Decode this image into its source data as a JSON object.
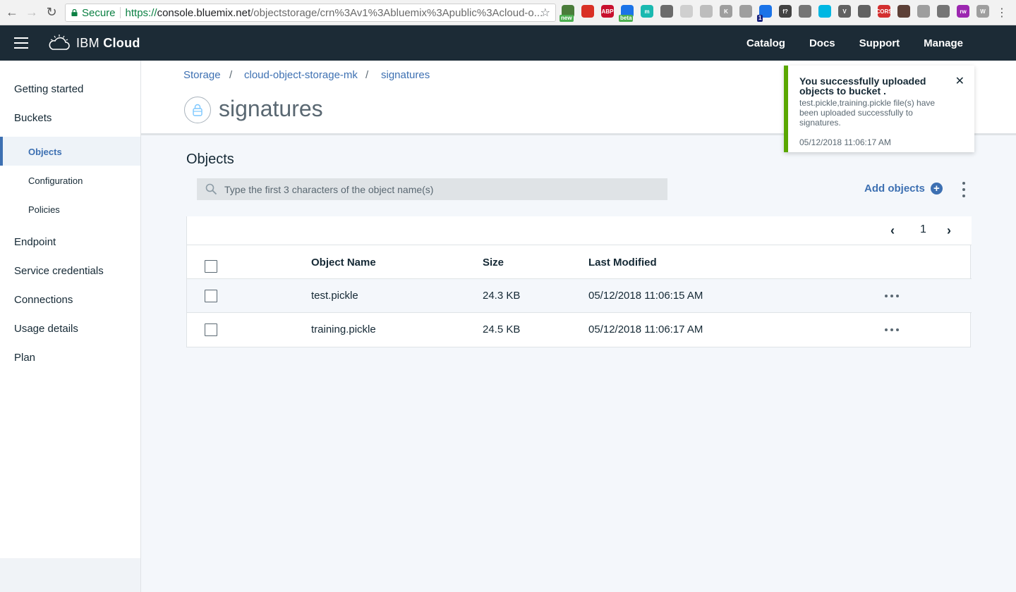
{
  "browser": {
    "secure_label": "Secure",
    "url_scheme": "https://",
    "url_host": "console.bluemix.net",
    "url_path": "/objectstorage/crn%3Av1%3Abluemix%3Apublic%3Acloud-o...",
    "extensions": [
      {
        "name": "ext-new",
        "badge": "new",
        "color": "#4a7c3a"
      },
      {
        "name": "ext-red",
        "badge": "",
        "color": "#d93025"
      },
      {
        "name": "ext-abp",
        "label": "ABP",
        "color": "#c8102e"
      },
      {
        "name": "ext-beta",
        "badge": "beta",
        "color": "#1a73e8"
      },
      {
        "name": "ext-m",
        "label": "m",
        "color": "#1ab9b0"
      },
      {
        "name": "ext-bug",
        "color": "#6b6b6b"
      },
      {
        "name": "ext-pin",
        "color": "#cfcfcf"
      },
      {
        "name": "ext-k",
        "color": "#bdbdbd"
      },
      {
        "name": "ext-kk",
        "label": "K",
        "color": "#9e9e9e"
      },
      {
        "name": "ext-ghost",
        "color": "#9e9e9e"
      },
      {
        "name": "ext-one",
        "badge": "1",
        "color": "#1a73e8"
      },
      {
        "name": "ext-f",
        "label": "f?",
        "color": "#424242"
      },
      {
        "name": "ext-pen",
        "color": "#757575"
      },
      {
        "name": "ext-react",
        "color": "#00b7e3"
      },
      {
        "name": "ext-v",
        "label": "V",
        "color": "#616161"
      },
      {
        "name": "ext-target",
        "color": "#616161"
      },
      {
        "name": "ext-cors",
        "label": "CORS",
        "color": "#d32f2f"
      },
      {
        "name": "ext-hat",
        "color": "#5d4037"
      },
      {
        "name": "ext-box",
        "color": "#9e9e9e"
      },
      {
        "name": "ext-screen",
        "color": "#757575"
      },
      {
        "name": "ext-rw",
        "label": "rw",
        "color": "#9c27b0"
      },
      {
        "name": "ext-w",
        "label": "W",
        "color": "#9e9e9e"
      }
    ]
  },
  "header": {
    "brand_prefix": "IBM ",
    "brand_bold": "Cloud",
    "nav": [
      "Catalog",
      "Docs",
      "Support",
      "Manage"
    ]
  },
  "sidebar": {
    "items": [
      {
        "label": "Getting started"
      },
      {
        "label": "Buckets"
      },
      {
        "label": "Objects",
        "sub": true,
        "active": true
      },
      {
        "label": "Configuration",
        "sub": true
      },
      {
        "label": "Policies",
        "sub": true
      },
      {
        "label": "Endpoint"
      },
      {
        "label": "Service credentials"
      },
      {
        "label": "Connections"
      },
      {
        "label": "Usage details"
      },
      {
        "label": "Plan"
      }
    ]
  },
  "breadcrumb": [
    "Storage",
    "cloud-object-storage-mk",
    "signatures"
  ],
  "page": {
    "title": "signatures",
    "section_title": "Objects",
    "search_placeholder": "Type the first 3 characters of the object name(s)",
    "add_objects_label": "Add objects"
  },
  "pagination": {
    "page": "1"
  },
  "table": {
    "columns": [
      "Object Name",
      "Size",
      "Last Modified"
    ],
    "rows": [
      {
        "name": "test.pickle",
        "size": "24.3 KB",
        "modified": "05/12/2018 11:06:15 AM"
      },
      {
        "name": "training.pickle",
        "size": "24.5 KB",
        "modified": "05/12/2018 11:06:17 AM"
      }
    ]
  },
  "toast": {
    "title": "You successfully uploaded objects to bucket .",
    "message": "test.pickle,training.pickle file(s) have been uploaded successfully to signatures.",
    "time": "05/12/2018 11:06:17 AM",
    "accent_color": "#5aa700"
  }
}
